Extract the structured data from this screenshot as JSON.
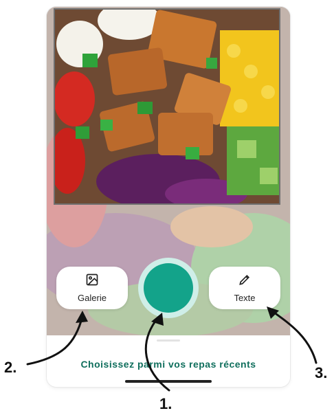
{
  "camera": {
    "gallery_label": "Galerie",
    "text_label": "Texte",
    "gallery_icon": "image-icon",
    "text_icon": "pencil-icon",
    "shutter_color": "#13a38a",
    "shutter_ring_color": "#cfeee8"
  },
  "sheet": {
    "title": "Choisissez parmi vos repas récents",
    "accent": "#0f6e5c"
  },
  "callouts": [
    "1.",
    "2.",
    "3."
  ]
}
